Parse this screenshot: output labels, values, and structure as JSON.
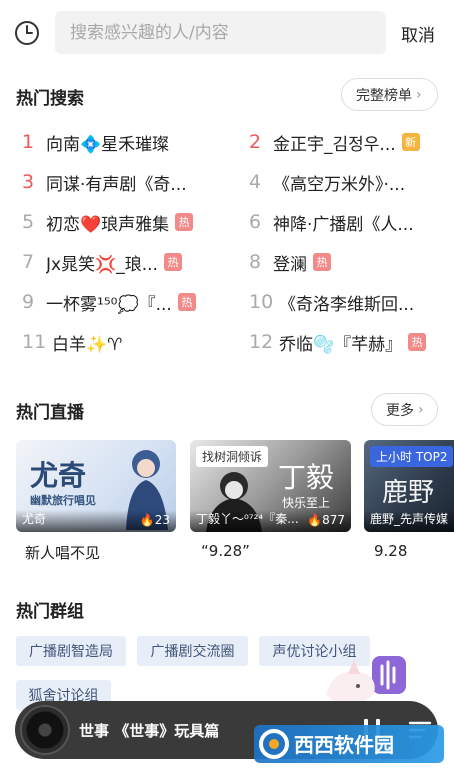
{
  "search": {
    "placeholder": "搜索感兴趣的人/内容",
    "cancel_label": "取消"
  },
  "hot_search": {
    "title": "热门搜索",
    "more_label": "完整榜单",
    "items": [
      {
        "rank": "1",
        "text": "向南💠星禾璀璨",
        "badge": ""
      },
      {
        "rank": "2",
        "text": "金正宇_김정우...",
        "badge": "新"
      },
      {
        "rank": "3",
        "text": "同谋·有声剧《奇...",
        "badge": ""
      },
      {
        "rank": "4",
        "text": "《高空万米外》·...",
        "badge": ""
      },
      {
        "rank": "5",
        "text": "初恋❤️琅声雅集",
        "badge": "热"
      },
      {
        "rank": "6",
        "text": "神降·广播剧《人...",
        "badge": ""
      },
      {
        "rank": "7",
        "text": "Jx晁笑💢_琅...",
        "badge": "热"
      },
      {
        "rank": "8",
        "text": "登澜",
        "badge": "热"
      },
      {
        "rank": "9",
        "text": "一杯雾¹⁵⁰💭『...",
        "badge": "热"
      },
      {
        "rank": "10",
        "text": "《奇洛李维斯回...",
        "badge": ""
      },
      {
        "rank": "11",
        "text": "白羊✨♈",
        "badge": ""
      },
      {
        "rank": "12",
        "text": "乔临🫧『芊赫』",
        "badge": "热"
      }
    ]
  },
  "hot_live": {
    "title": "热门直播",
    "more_label": "更多",
    "items": [
      {
        "caption": "新人唱不见",
        "streamer": "尤奇",
        "count": "23",
        "tag": "",
        "art_title": "尤奇",
        "art_sub": "幽默旅行唱见"
      },
      {
        "caption": "“9.28”",
        "streamer": "丁毅丫～⁰⁷²⁴『秦...",
        "count": "877",
        "tag": "找树洞倾诉",
        "art_title": "丁毅",
        "art_sub": "快乐至上"
      },
      {
        "caption": "9.28",
        "streamer": "鹿野_先声传媒",
        "count": "",
        "tag": "上小时 TOP2",
        "art_title": "鹿野",
        "art_sub": ""
      }
    ]
  },
  "hot_groups": {
    "title": "热门群组",
    "items": [
      "广播剧智造局",
      "广播剧交流圈",
      "声优讨论小组",
      "狐舍讨论组"
    ]
  },
  "player": {
    "title": "世事 《世事》玩具篇"
  },
  "watermark": {
    "text": "西西软件园"
  },
  "colors": {
    "accent_red": "#ef5a56",
    "hot_badge": "#f38a8a",
    "new_badge": "#f3b53f",
    "chip_bg": "#e8eef8",
    "player_bg": "#3a3a3a"
  }
}
